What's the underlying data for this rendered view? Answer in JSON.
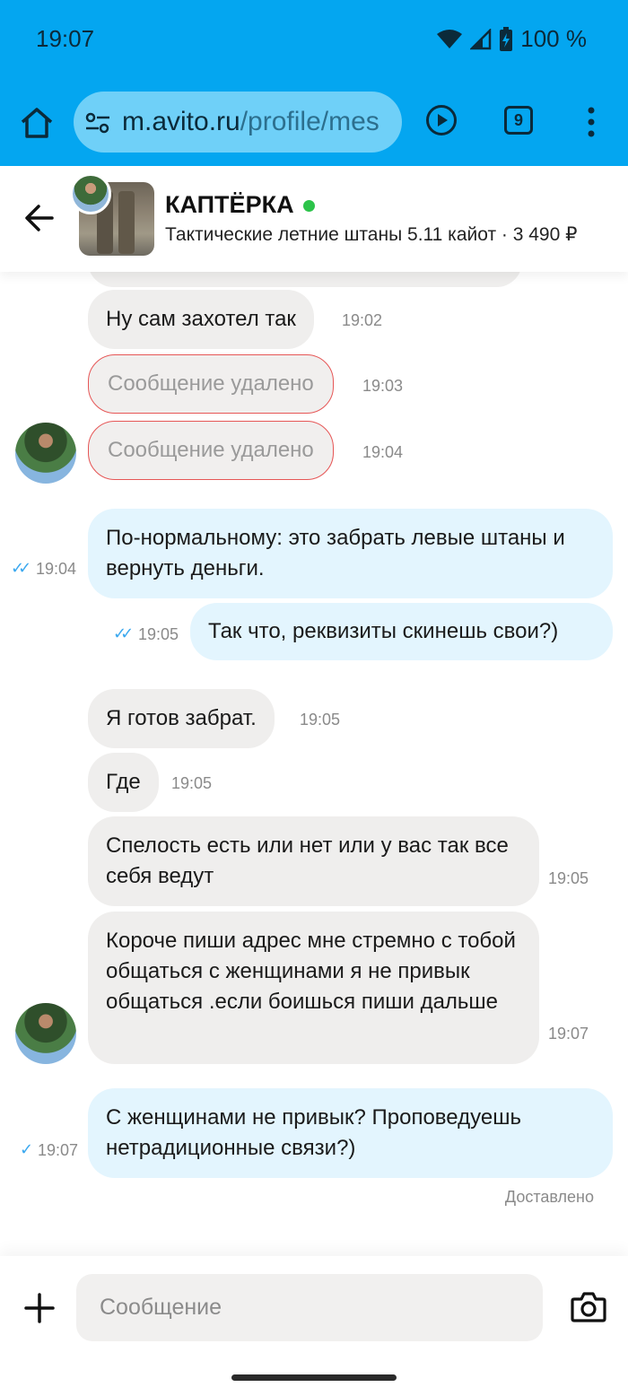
{
  "status_bar": {
    "time": "19:07",
    "battery": "100 %",
    "icons": [
      "wifi-icon",
      "signal-icon",
      "battery-charging-icon"
    ]
  },
  "browser": {
    "url_main": "m.avito.ru",
    "url_path": "/profile/mes",
    "tab_count": "9",
    "icons": [
      "home-icon",
      "site-settings-icon",
      "play-icon",
      "tabs-icon",
      "more-vert-icon"
    ]
  },
  "chat_header": {
    "seller_name": "КАПТЁРКА",
    "item_line": "Тактические летние штаны 5.11 кайот · 3 490 ₽",
    "online": true,
    "icons": [
      "back-arrow-icon"
    ]
  },
  "messages": [
    {
      "dir": "in",
      "text": "Ну сам захотел так",
      "time": "19:02"
    },
    {
      "dir": "in",
      "text": "Сообщение удалено",
      "time": "19:03",
      "deleted": true
    },
    {
      "dir": "in",
      "text": "Сообщение удалено",
      "time": "19:04",
      "deleted": true
    },
    {
      "dir": "out",
      "text": "По-нормальному: это забрать левые штаны и вернуть деньги.",
      "time": "19:04",
      "status": "read"
    },
    {
      "dir": "out",
      "text": "Так что, реквизиты скинешь свои?)",
      "time": "19:05",
      "status": "read"
    },
    {
      "dir": "in",
      "text": "Я готов забрат.",
      "time": "19:05"
    },
    {
      "dir": "in",
      "text": "Где",
      "time": "19:05"
    },
    {
      "dir": "in",
      "text": "Спелость есть или нет или у вас так все себя ведут",
      "time": "19:05"
    },
    {
      "dir": "in",
      "text": "Короче пиши адрес мне стремно с тобой общаться с женщинами я не привык общаться .если боишься пиши дальше",
      "time": "19:07"
    },
    {
      "dir": "out",
      "text": "С женщинами не привык? Проповедуешь нетрадиционные связи?)",
      "time": "19:07",
      "status": "sent"
    }
  ],
  "delivered_label": "Доставлено",
  "input": {
    "placeholder": "Сообщение",
    "value": ""
  },
  "colors": {
    "browser_bar": "#04a6f0",
    "incoming": "#efeeed",
    "outgoing": "#e3f5fe",
    "deleted_border": "#e65656",
    "online": "#2cc34a",
    "tick": "#3aa8ef"
  }
}
